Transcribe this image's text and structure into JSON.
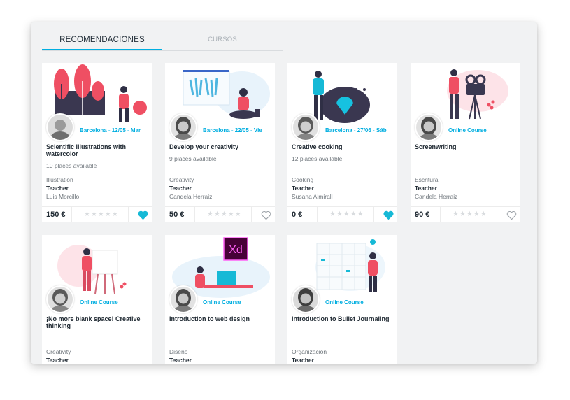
{
  "tabs": [
    {
      "label": "RECOMENDACIONES",
      "active": true
    },
    {
      "label": "CURSOS",
      "active": false
    }
  ],
  "rating_stars": "★★★★★",
  "colors": {
    "accent": "#00aee0",
    "text_dark": "#202a33",
    "text_muted": "#6f767c",
    "illustration_pink": "#ef4f63"
  },
  "courses": [
    {
      "meta": "Barcelona - 12/05 - Mar",
      "title": "Scientific illustrations with watercolor",
      "places": "10 places available",
      "category": "Illustration",
      "role": "Teacher",
      "teacher": "Luis Morcillo",
      "price": "150 €",
      "favorite": true,
      "illustration": "trees-icon"
    },
    {
      "meta": "Barcelona - 22/05 - Vie",
      "title": "Develop your creativity",
      "places": "9 places available",
      "category": "Creativity",
      "role": "Teacher",
      "teacher": "Candela Herraiz",
      "price": "50 €",
      "favorite": false,
      "illustration": "canvas-icon"
    },
    {
      "meta": "Barcelona - 27/06 - Sáb",
      "title": "Creative cooking",
      "places": "12 places available",
      "category": "Cooking",
      "role": "Teacher",
      "teacher": "Susana Almirall",
      "price": "0 €",
      "favorite": true,
      "illustration": "cooking-icon"
    },
    {
      "meta": "Online Course",
      "title": "Screenwriting",
      "places": "",
      "category": "Escritura",
      "role": "Teacher",
      "teacher": "Candela Herraiz",
      "price": "90 €",
      "favorite": false,
      "illustration": "movie-camera-icon"
    },
    {
      "meta": "Online Course",
      "title": "¡No more blank space! Creative thinking",
      "places": "",
      "category": "Creativity",
      "role": "Teacher",
      "teacher": "",
      "price": "",
      "favorite": false,
      "illustration": "easel-icon"
    },
    {
      "meta": "Online Course",
      "title": "Introduction to web design",
      "places": "",
      "category": "Diseño",
      "role": "Teacher",
      "teacher": "",
      "price": "",
      "favorite": false,
      "illustration": "web-design-icon",
      "badge": "Xd"
    },
    {
      "meta": "Online Course",
      "title": "Introduction to Bullet Journaling",
      "places": "",
      "category": "Organización",
      "role": "Teacher",
      "teacher": "",
      "price": "",
      "favorite": false,
      "illustration": "calendar-icon"
    }
  ]
}
